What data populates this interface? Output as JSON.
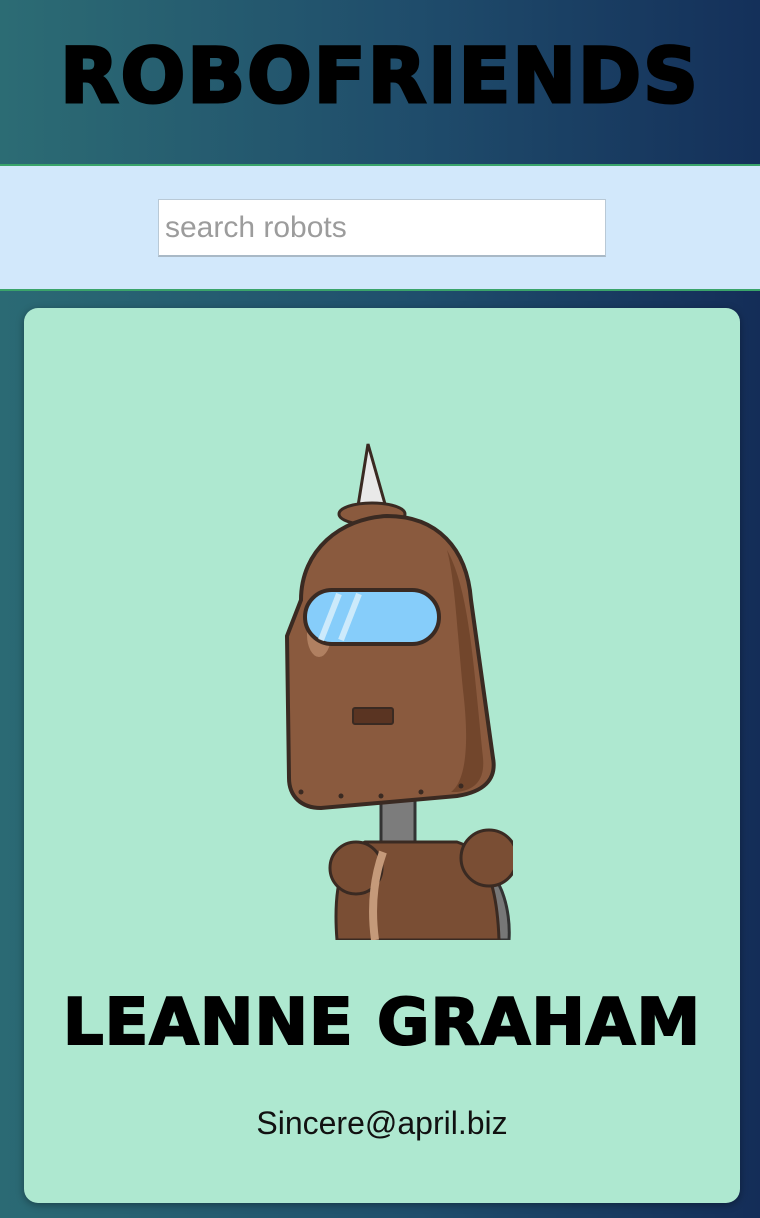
{
  "header": {
    "title": "ROBOFRIENDS"
  },
  "search": {
    "placeholder": "search robots",
    "value": ""
  },
  "cards": [
    {
      "name": "LEANNE GRAHAM",
      "email": "Sincere@april.biz",
      "avatar_icon": "robot-avatar"
    }
  ],
  "colors": {
    "card_background": "#aee8d0",
    "search_band": "#d2e8fb",
    "divider": "#3aa46a"
  }
}
